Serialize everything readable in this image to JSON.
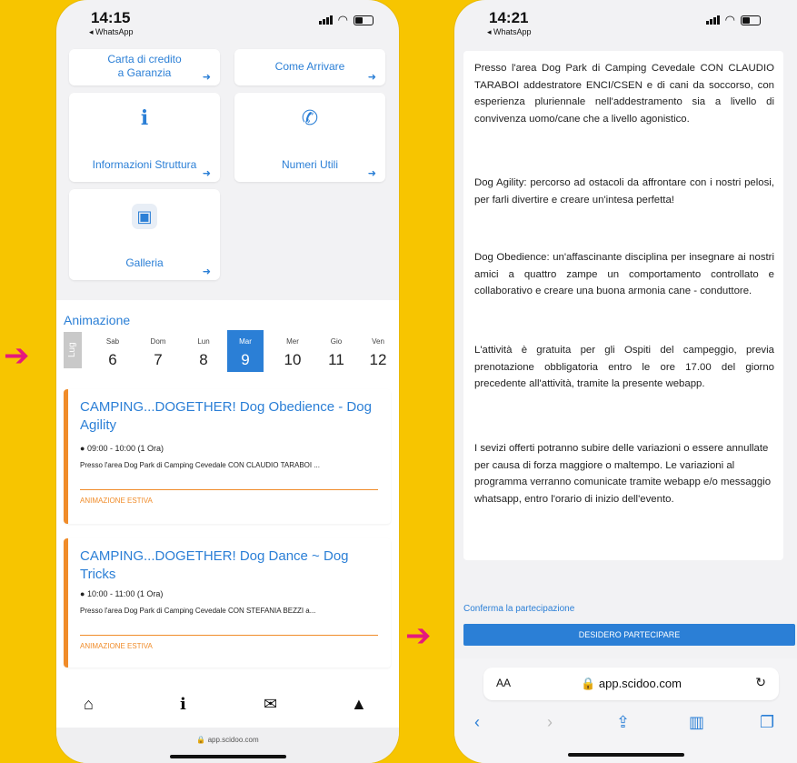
{
  "left": {
    "status": {
      "time": "14:15",
      "back_label": "◂ WhatsApp"
    },
    "tiles": [
      {
        "label": "Carta di credito a Garanzia",
        "icon": "card-icon"
      },
      {
        "label": "Come Arrivare",
        "icon": "map-icon"
      },
      {
        "label": "Informazioni Struttura",
        "icon": "info-icon",
        "glyph": "i"
      },
      {
        "label": "Numeri Utili",
        "icon": "phone-icon",
        "glyph": "✆"
      },
      {
        "label": "Galleria",
        "icon": "gallery-icon",
        "glyph": "▣"
      }
    ],
    "section_title": "Animazione",
    "month": "Lug",
    "days": [
      {
        "name": "Sab",
        "num": "6"
      },
      {
        "name": "Dom",
        "num": "7"
      },
      {
        "name": "Lun",
        "num": "8"
      },
      {
        "name": "Mar",
        "num": "9",
        "active": true
      },
      {
        "name": "Mer",
        "num": "10"
      },
      {
        "name": "Gio",
        "num": "11"
      },
      {
        "name": "Ven",
        "num": "12"
      }
    ],
    "events": [
      {
        "title": "CAMPING...DOGETHER! Dog Obedience - Dog Agility",
        "time": "09:00 - 10:00 (1 Ora)",
        "desc": "Presso l'area Dog Park di Camping Cevedale CON CLAUDIO TARABOI ...",
        "tag": "ANIMAZIONE ESTIVA"
      },
      {
        "title": "CAMPING...DOGETHER! Dog Dance ~ Dog Tricks",
        "time": "10:00 - 11:00 (1 Ora)",
        "desc": "Presso l'area Dog Park di Camping Cevedale CON STEFANIA BEZZI a...",
        "tag": "ANIMAZIONE ESTIVA"
      }
    ],
    "url": "app.scidoo.com"
  },
  "right": {
    "status": {
      "time": "14:21",
      "back_label": "◂ WhatsApp"
    },
    "paragraphs": [
      "Presso l'area Dog Park di Camping Cevedale CON CLAUDIO TARABOI addestratore ENCI/CSEN e di cani da soccorso, con esperienza pluriennale nell'addestramento sia a livello di convivenza uomo/cane che a livello agonistico.",
      "Dog Agility: percorso ad ostacoli da affrontare con i nostri pelosi, per farli divertire e creare un'intesa perfetta!",
      "Dog Obedience: un'affascinante disciplina per insegnare ai nostri amici a quattro zampe un comportamento controllato e collaborativo e creare una buona armonia cane - conduttore.",
      "L'attività è gratuita per gli Ospiti del campeggio, previa prenotazione obbligatoria entro le ore 17.00 del giorno precedente all'attività, tramite la presente webapp.",
      "I sevizi offerti potranno subire delle variazioni o essere annullate per causa di forza maggiore o maltempo. Le variazioni al programma verranno comunicate tramite webapp e/o messaggio whatsapp, entro l'orario di inizio dell'evento."
    ],
    "confirm_label": "Conferma la partecipazione",
    "join_button": "DESIDERO PARTECIPARE",
    "addr_aa": "AA",
    "url": "app.scidoo.com"
  },
  "colors": {
    "accent": "#2b7fd6",
    "orange": "#f08c2a",
    "background": "#f7c500",
    "arrow": "#e6197c"
  }
}
